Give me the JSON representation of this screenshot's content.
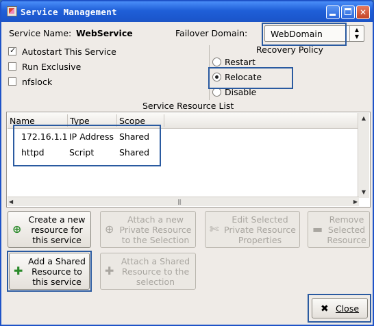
{
  "window": {
    "title": "Service Management"
  },
  "service": {
    "name_label": "Service Name:",
    "name_value": "WebService",
    "failover_label": "Failover Domain:",
    "failover_value": "WebDomain"
  },
  "options": [
    {
      "label": "Autostart This Service",
      "checked": true
    },
    {
      "label": "Run Exclusive",
      "checked": false
    },
    {
      "label": "nfslock",
      "checked": false
    }
  ],
  "recovery": {
    "title": "Recovery Policy",
    "choices": [
      {
        "label": "Restart",
        "selected": false
      },
      {
        "label": "Relocate",
        "selected": true
      },
      {
        "label": "Disable",
        "selected": false
      }
    ]
  },
  "resource_list": {
    "title": "Service Resource List",
    "columns": [
      "Name",
      "Type",
      "Scope"
    ],
    "rows": [
      {
        "name": "172.16.1.1",
        "type": "IP Address",
        "scope": "Shared"
      },
      {
        "name": "httpd",
        "type": "Script",
        "scope": "Shared"
      }
    ]
  },
  "buttons": {
    "create_new": "Create a new resource for this service",
    "attach_new_private": "Attach a new Private Resource to the Selection",
    "edit_selected_private": "Edit Selected Private Resource Properties",
    "remove_selected": "Remove Selected Resource",
    "add_shared": "Add a Shared Resource to this service",
    "attach_shared": "Attach a Shared Resource to the selection",
    "close": "Close"
  },
  "icons": {
    "app": "cluster-app-icon",
    "minimize": "minimize-icon",
    "maximize": "maximize-icon",
    "window_close": "close-icon"
  },
  "colors": {
    "titlebar": "#1f5fd8",
    "dialog_bg": "#efebe7",
    "highlight_box": "#2a5aa0",
    "disabled_text": "#a9a6a0"
  }
}
